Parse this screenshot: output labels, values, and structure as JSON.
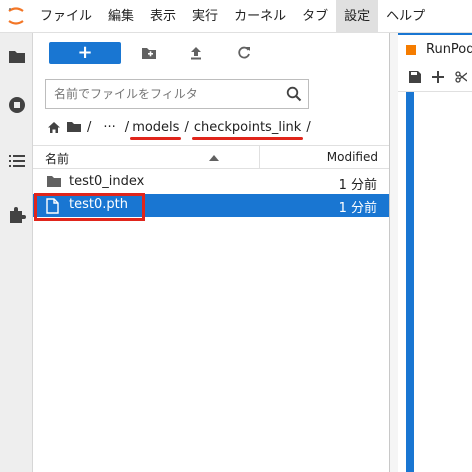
{
  "menu": {
    "items": [
      "ファイル",
      "編集",
      "表示",
      "実行",
      "カーネル",
      "タブ",
      "設定",
      "ヘルプ"
    ],
    "active_index": 6
  },
  "toolbar": {
    "new_label": "+"
  },
  "filter": {
    "placeholder": "名前でファイルをフィルタ"
  },
  "breadcrumbs": {
    "sep": "/",
    "ellipsis": "···",
    "items": [
      "models",
      "checkpoints_link"
    ]
  },
  "listing": {
    "header_name": "名前",
    "header_modified": "Modified",
    "rows": [
      {
        "name": "test0_index",
        "modified": "1 分前",
        "kind": "folder"
      },
      {
        "name": "test0.pth",
        "modified": "1 分前",
        "kind": "file",
        "selected": true
      }
    ]
  },
  "editor": {
    "tab_label": "RunPod_"
  },
  "colors": {
    "accent": "#1976d2",
    "highlight": "#e0251b"
  }
}
